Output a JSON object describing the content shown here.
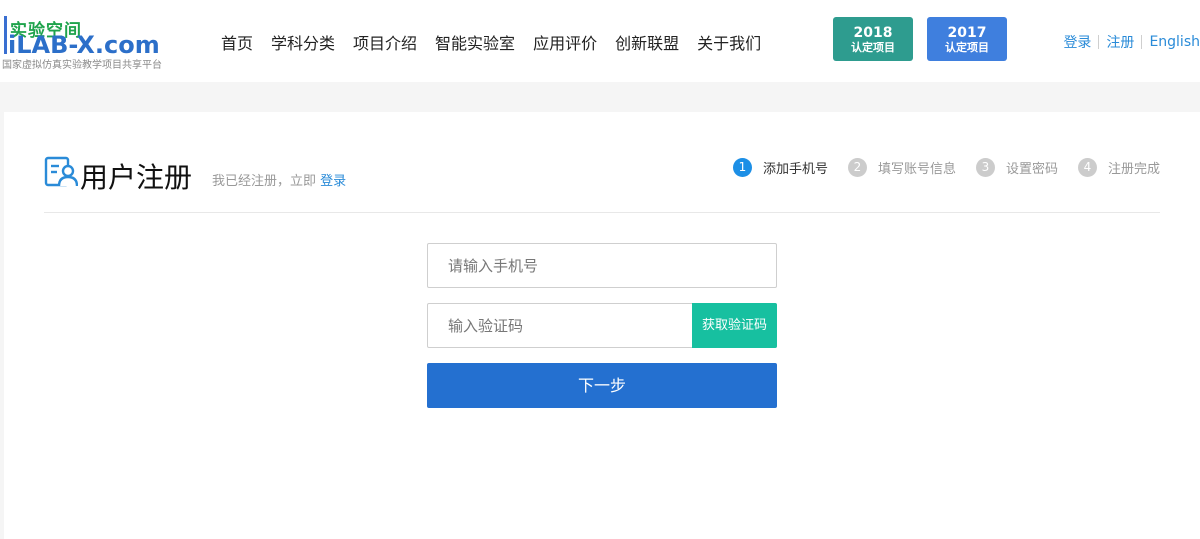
{
  "header": {
    "logo": {
      "cn": "实验空间",
      "en": "iLAB-X.com",
      "sub": "国家虚拟仿真实验教学项目共享平台"
    },
    "nav": [
      "首页",
      "学科分类",
      "项目介绍",
      "智能实验室",
      "应用评价",
      "创新联盟",
      "关于我们"
    ],
    "badges": [
      {
        "year": "2018",
        "label": "认定项目",
        "color": "#2e9c8f"
      },
      {
        "year": "2017",
        "label": "认定项目",
        "color": "#3f7fde"
      }
    ],
    "links": {
      "login": "登录",
      "register": "注册",
      "english": "English"
    }
  },
  "register": {
    "title": "用户注册",
    "hint": "我已经注册，立即",
    "hint_link": "登录",
    "steps": [
      {
        "num": "1",
        "label": "添加手机号",
        "active": true
      },
      {
        "num": "2",
        "label": "填写账号信息",
        "active": false
      },
      {
        "num": "3",
        "label": "设置密码",
        "active": false
      },
      {
        "num": "4",
        "label": "注册完成",
        "active": false
      }
    ],
    "form": {
      "phone_placeholder": "请输入手机号",
      "code_placeholder": "输入验证码",
      "get_code_label": "获取验证码",
      "next_label": "下一步"
    }
  },
  "colors": {
    "accent": "#2a8bd8",
    "primary_button": "#2470d0",
    "code_button": "#17c0a0",
    "active_step": "#1c8fe6"
  }
}
